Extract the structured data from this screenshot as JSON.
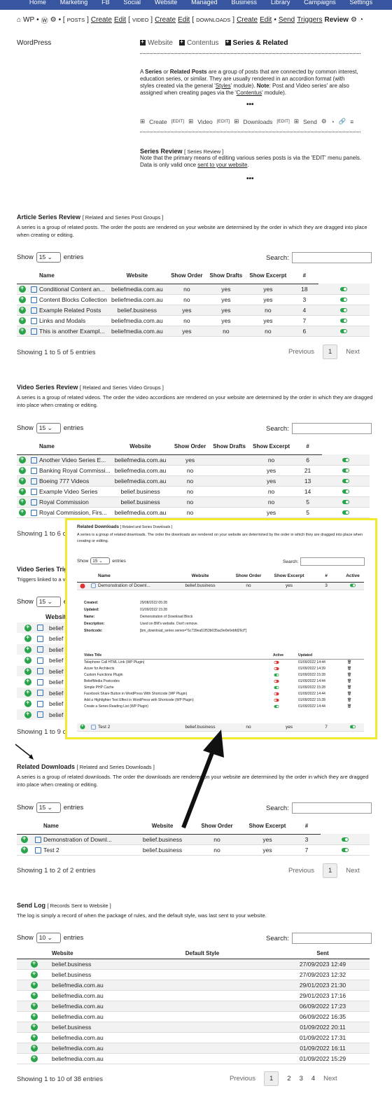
{
  "topnav": [
    "Home",
    "Marketing",
    "FB",
    "Social",
    "Website",
    "Managed",
    "Business",
    "Library",
    "Campaigns",
    "Settings"
  ],
  "crumbs": {
    "wp": "WP",
    "posts": "POSTS",
    "create1": "Create",
    "edit1": "Edit",
    "video": "VIDEO",
    "create2": "Create",
    "edit2": "Edit",
    "downloads": "DOWNLOADS",
    "create3": "Create",
    "edit3": "Edit",
    "send": "Send",
    "triggers": "Triggers",
    "review": "Review"
  },
  "logo": "WordPress",
  "tabs": [
    "Website",
    "Contentus",
    "Series & Related"
  ],
  "intro": {
    "p1a": "A ",
    "series": "Series",
    "or": " or ",
    "related": "Related Posts",
    "p1b": " are a group of posts that are connected by common interest, education series, or similar. They are usually rendered in an accordion format (with styles created via the general '",
    "styles": "Styles",
    "p1c": "' module). ",
    "note": "Note",
    "p1d": ": Post and Video series' are also assigned when creating pages via the '",
    "contentus": "Contentus",
    "p1e": "' module)."
  },
  "tools": {
    "create": "Create",
    "edit1": "EDIT",
    "video": "Video",
    "edit2": "EDIT",
    "downloads": "Downloads",
    "edit3": "EDIT",
    "send": "Send"
  },
  "series_review": {
    "title": "Series Review",
    "sub": "[ Series Review ]",
    "body": "Note that the primary means of editing various series posts is via the 'EDIT' menu panels. Data is only valid once ",
    "link": "sent to your website",
    "end": "."
  },
  "article": {
    "title": "Article Series Review",
    "sub": "[ Related and Series Post Groups ]",
    "desc": "A series is a group of related posts. The order the posts are rendered on your website are determined by the order in which they are dragged into place when creating or editing.",
    "show": "Show",
    "entries_n": "15",
    "entries": "entries",
    "search": "Search:",
    "cols": [
      "Name",
      "Website",
      "Show Order",
      "Show Drafts",
      "Show Excerpt",
      "#",
      "Active"
    ],
    "rows": [
      [
        "Conditional Content an...",
        "beliefmedia.com.au",
        "no",
        "yes",
        "yes",
        "18"
      ],
      [
        "Content Blocks Collection",
        "beliefmedia.com.au",
        "no",
        "yes",
        "yes",
        "3"
      ],
      [
        "Example Related Posts",
        "belief.business",
        "yes",
        "yes",
        "no",
        "4"
      ],
      [
        "Links and Modals",
        "beliefmedia.com.au",
        "no",
        "yes",
        "yes",
        "7"
      ],
      [
        "This is another Exampl...",
        "beliefmedia.com.au",
        "yes",
        "no",
        "no",
        "6"
      ]
    ],
    "info": "Showing 1 to 5 of 5 entries",
    "prev": "Previous",
    "page": "1",
    "next": "Next"
  },
  "video": {
    "title": "Video Series Review",
    "sub": "[ Related and Series Video Groups ]",
    "desc": "A series is a group of related videos. The order the video accordions are rendered on your website are determined by the order in which they are dragged into place when creating or editing.",
    "show": "Show",
    "entries_n": "15",
    "entries": "entries",
    "search": "Search:",
    "cols": [
      "Name",
      "Website",
      "Show Order",
      "Show Drafts",
      "Show Excerpt",
      "#",
      "Active"
    ],
    "rows": [
      [
        "Another Video Series E...",
        "beliefmedia.com.au",
        "yes",
        "",
        "no",
        "6"
      ],
      [
        "Banking Royal Commissi...",
        "beliefmedia.com.au",
        "no",
        "",
        "yes",
        "21"
      ],
      [
        "Boeing 777 Videos",
        "beliefmedia.com.au",
        "no",
        "",
        "yes",
        "13"
      ],
      [
        "Example Video Series",
        "belief.business",
        "no",
        "",
        "no",
        "14"
      ],
      [
        "Royal Commission",
        "belief.business",
        "no",
        "",
        "no",
        "5"
      ],
      [
        "Royal Commission, Firs...",
        "beliefmedia.com.au",
        "no",
        "",
        "yes",
        "5"
      ]
    ],
    "info": "Showing 1 to 6 c"
  },
  "triggers": {
    "title": "Video Series Trigg",
    "desc": "Triggers linked to a v",
    "show": "Show",
    "entries_n": "15",
    "entries": "e",
    "col": "Websit",
    "rows": [
      "belief",
      "belief",
      "belief",
      "belief",
      "belief",
      "belief",
      "belief",
      "belief",
      "belief"
    ],
    "info": "Showing 1 to 9 c"
  },
  "downloads": {
    "title": "Related Downloads",
    "sub": "[ Related and Series Downloads ]",
    "desc": "A series is a group of related downloads. The order the downloads are rendered on your website are determined by the order in which they are dragged into place when creating or editing.",
    "show": "Show",
    "entries_n": "15",
    "entries": "entries",
    "search": "Search:",
    "cols": [
      "Name",
      "Website",
      "Show Order",
      "Show Excerpt",
      "#",
      "Active"
    ],
    "rows": [
      [
        "Demonstration of Downl...",
        "belief.business",
        "no",
        "yes",
        "3"
      ],
      [
        "Test 2",
        "belief.business",
        "no",
        "yes",
        "7"
      ]
    ],
    "info": "Showing 1 to 2 of 2 entries",
    "prev": "Previous",
    "page": "1",
    "next": "Next"
  },
  "zoom": {
    "title": "Related Downloads",
    "sub": "[ Related and Series Downloads ]",
    "desc": "A series is a group of related downloads. The order the downloads are rendered on your website are determined by the order in which they are dragged into place when creating or editing.",
    "show": "Show",
    "entries_n": "15",
    "entries": "entries",
    "search": "Search:",
    "row1": [
      "Demonstration of Downl...",
      "belief.business",
      "no",
      "yes",
      "3"
    ],
    "kv": [
      [
        "Created:",
        "29/08/2022 05:28"
      ],
      [
        "Updated:",
        "01/09/2022 15:28"
      ],
      [
        "Name:",
        "Demonstration of Download Block"
      ],
      [
        "Description:",
        "Used on BM's website. Don't remove."
      ],
      [
        "Shortcode:",
        "[bm_download_series series=\"6c739ea51f53b035ac9e0e0ebfd26cf\"]"
      ]
    ],
    "vcols": [
      "Video Title",
      "Active",
      "Updated"
    ],
    "vrows": [
      [
        "Telephone Call HTML Link (WP Plugin)",
        "off",
        "01/09/2022 14:44"
      ],
      [
        "Azure for Architects",
        "off",
        "01/09/2022 14:39"
      ],
      [
        "Custom Functions Plugin",
        "on",
        "01/09/2022 15:28"
      ],
      [
        "BeliefMedia Postcodes",
        "off",
        "01/09/2022 14:44"
      ],
      [
        "Simple PHP Cache",
        "on",
        "01/09/2022 15:28"
      ],
      [
        "Facebook Share Button in WordPress With Shortcode (WP Plugin)",
        "off",
        "01/09/2022 14:44"
      ],
      [
        "Add a Highlighter Text Effect in WordPress with Shortcode (WP Plugin)",
        "off",
        "01/09/2022 15:28"
      ],
      [
        "Create a Series Reading List (WP Plugin)",
        "on",
        "01/09/2022 14:44"
      ]
    ],
    "row2": [
      "Test 2",
      "belief.business",
      "no",
      "yes",
      "7"
    ]
  },
  "sendlog": {
    "title": "Send Log",
    "sub": "[ Records Sent to Website ]",
    "desc": "The log is simply a record of when the package of rules, and the default style, was last sent to your website.",
    "show": "Show",
    "entries_n": "10",
    "entries": "entries",
    "search": "Search:",
    "cols": [
      "Website",
      "Default Style",
      "Sent"
    ],
    "rows": [
      [
        "belief.business",
        "27/09/2023 12:49"
      ],
      [
        "belief.business",
        "27/09/2023 12:32"
      ],
      [
        "beliefmedia.com.au",
        "29/01/2023 21:30"
      ],
      [
        "beliefmedia.com.au",
        "29/01/2023 17:16"
      ],
      [
        "beliefmedia.com.au",
        "06/09/2022 17:23"
      ],
      [
        "beliefmedia.com.au",
        "06/09/2022 16:35"
      ],
      [
        "belief.business",
        "01/09/2022 20:11"
      ],
      [
        "beliefmedia.com.au",
        "01/09/2022 17:31"
      ],
      [
        "beliefmedia.com.au",
        "01/09/2022 16:11"
      ],
      [
        "beliefmedia.com.au",
        "01/09/2022 15:29"
      ]
    ],
    "info": "Showing 1 to 10 of 38 entries",
    "prev": "Previous",
    "pages": [
      "1",
      "2",
      "3",
      "4"
    ],
    "next": "Next"
  }
}
